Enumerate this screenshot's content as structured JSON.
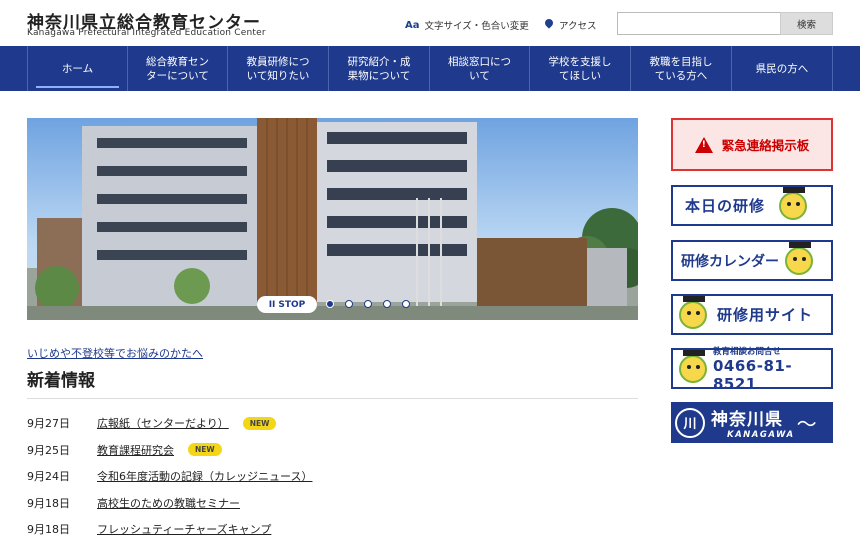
{
  "header": {
    "logo_ja": "神奈川県立総合教育センター",
    "logo_en": "Kanagawa Prefectural Integrated Education Center",
    "text_size_label": "文字サイズ・色合い変更",
    "access_label": "アクセス",
    "search_placeholder": "",
    "search_button": "検索"
  },
  "nav": {
    "items": [
      {
        "label": "ホーム"
      },
      {
        "label": "総合教育セン\nターについて"
      },
      {
        "label": "教員研修につ\nいて知りたい"
      },
      {
        "label": "研究紹介・成\n果物について"
      },
      {
        "label": "相談窓口につ\nいて"
      },
      {
        "label": "学校を支援し\nてほしい"
      },
      {
        "label": "教職を目指し\nている方へ"
      },
      {
        "label": "県民の方へ"
      }
    ]
  },
  "hero": {
    "stop_label": "STOP",
    "slide_count": 5,
    "active_slide": 1
  },
  "main": {
    "consult_link": "いじめや不登校等でお悩みのかたへ",
    "news_title": "新着情報",
    "news": [
      {
        "date": "9月27日",
        "text": "広報紙（センターだより）",
        "badge": "NEW"
      },
      {
        "date": "9月25日",
        "text": "教育課程研究会",
        "badge": "NEW"
      },
      {
        "date": "9月24日",
        "text": "令和6年度活動の記録（カレッジニュース）",
        "badge": ""
      },
      {
        "date": "9月18日",
        "text": "高校生のための教職セミナー",
        "badge": ""
      },
      {
        "date": "9月18日",
        "text": "フレッシュティーチャーズキャンプ",
        "badge": ""
      }
    ]
  },
  "side": {
    "emergency": "緊急連絡掲示板",
    "today_training": "本日の研修",
    "calendar": "研修カレンダー",
    "training_site": "研修用サイト",
    "phone_label": "教育相談お問合せ",
    "phone_number": "0466-81-8521",
    "kanagawa_ja": "神奈川県",
    "kanagawa_en": "KANAGAWA"
  },
  "colors": {
    "brand": "#1f3a8c",
    "emergency": "#cc0000",
    "badge": "#f3d616"
  }
}
